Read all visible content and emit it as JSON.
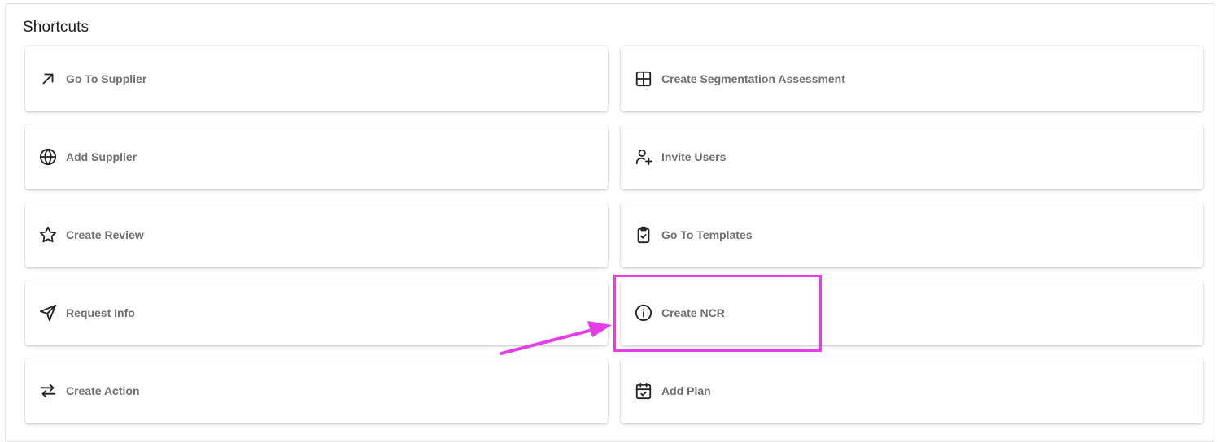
{
  "panel": {
    "title": "Shortcuts"
  },
  "shortcuts": {
    "go_to_supplier": {
      "label": "Go To Supplier",
      "icon": "arrow-up-right-icon"
    },
    "create_segmentation_assessment": {
      "label": "Create Segmentation Assessment",
      "icon": "grid-icon"
    },
    "add_supplier": {
      "label": "Add Supplier",
      "icon": "globe-icon"
    },
    "invite_users": {
      "label": "Invite Users",
      "icon": "user-plus-icon"
    },
    "create_review": {
      "label": "Create Review",
      "icon": "star-icon"
    },
    "go_to_templates": {
      "label": "Go To Templates",
      "icon": "clipboard-check-icon"
    },
    "request_info": {
      "label": "Request Info",
      "icon": "send-icon"
    },
    "create_ncr": {
      "label": "Create NCR",
      "icon": "info-circle-icon"
    },
    "create_action": {
      "label": "Create Action",
      "icon": "arrows-right-left-icon"
    },
    "add_plan": {
      "label": "Add Plan",
      "icon": "calendar-check-icon"
    }
  },
  "colors": {
    "label": "#6f6f6f",
    "annotation": "#e63ee6"
  }
}
